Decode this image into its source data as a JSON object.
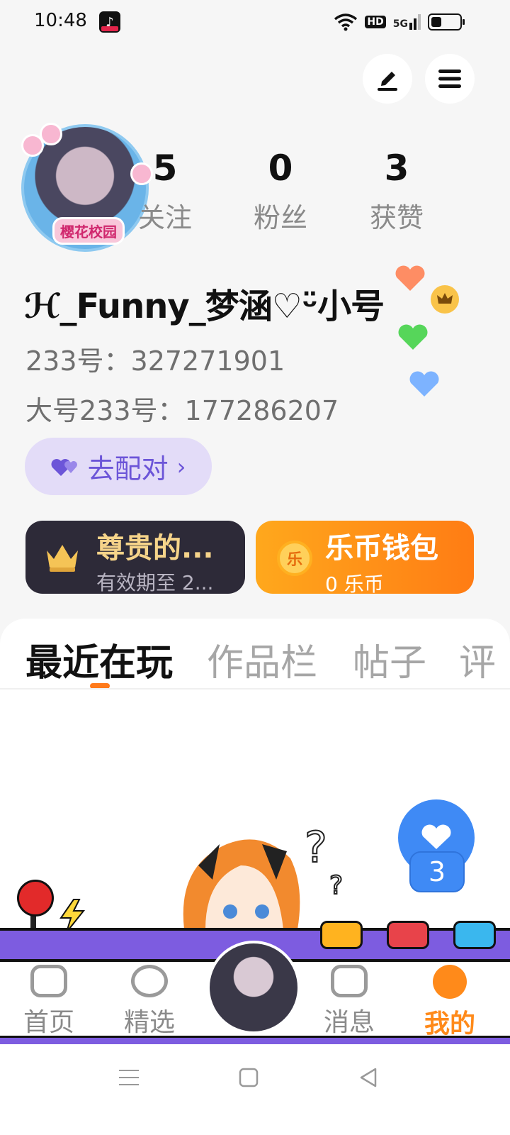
{
  "status_bar": {
    "time": "10:48",
    "hd": "HD",
    "network": "5G"
  },
  "profile": {
    "avatar_badge": "樱花校园",
    "stats": [
      {
        "value": "5",
        "label": "关注"
      },
      {
        "value": "0",
        "label": "粉丝"
      },
      {
        "value": "3",
        "label": "获赞"
      }
    ],
    "username": "ℋ_Funny_梦涵♡ᵕ̈小号",
    "id_line": "233号：327271901",
    "main_id_line": "大号233号：177286207",
    "pair_button": "去配对"
  },
  "cards": {
    "vip_title": "尊贵的...",
    "vip_subtitle": "有效期至 2...",
    "coin_title": "乐币钱包",
    "coin_icon": "乐",
    "coin_subtitle": "0 乐币"
  },
  "tabs": [
    {
      "label": "最近在玩"
    },
    {
      "label": "作品栏"
    },
    {
      "label": "帖子"
    },
    {
      "label": "评"
    }
  ],
  "like_fab": {
    "count": "3"
  },
  "bottom_nav": [
    {
      "label": "首页"
    },
    {
      "label": "精选"
    },
    {
      "label": "消息"
    },
    {
      "label": "我的"
    }
  ],
  "colors": {
    "accent": "#ff7a1a",
    "pair": "#6c55d8",
    "fab": "#3f8af5",
    "nav_bar": "#7d5ce0"
  }
}
